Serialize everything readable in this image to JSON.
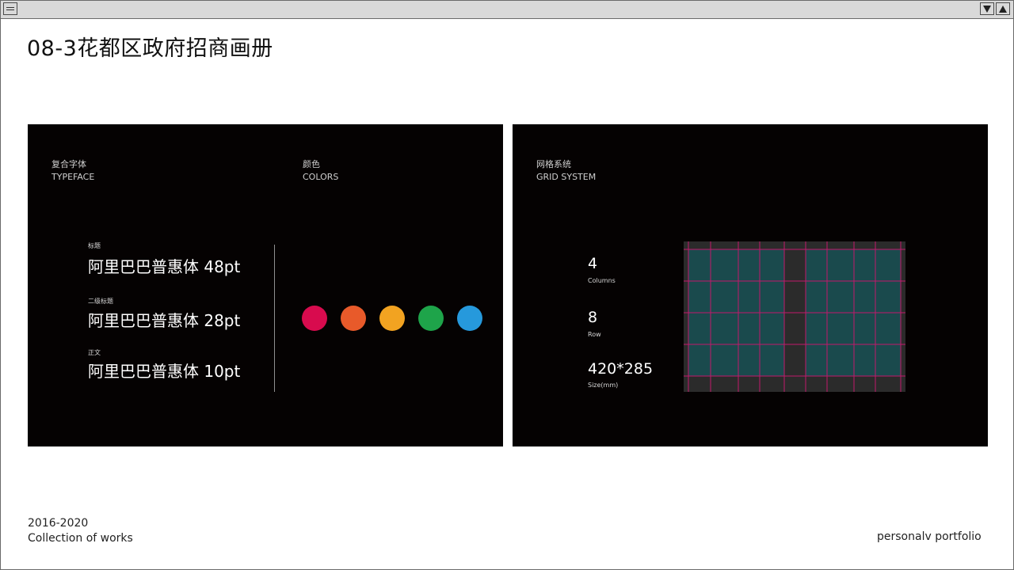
{
  "page_title": "08-3花都区政府招商画册",
  "left_panel": {
    "typeface_cn": "复合字体",
    "typeface_en": "TYPEFACE",
    "colors_cn": "颜色",
    "colors_en": "COLORS",
    "fonts": [
      {
        "label": "标题",
        "sample": "阿里巴巴普惠体 48pt"
      },
      {
        "label": "二级标题",
        "sample": "阿里巴巴普惠体 28pt"
      },
      {
        "label": "正文",
        "sample": "阿里巴巴普惠体 10pt"
      }
    ],
    "swatches": [
      "#d80b4e",
      "#e85a2a",
      "#f2a321",
      "#1ea44a",
      "#2699dc"
    ]
  },
  "right_panel": {
    "grid_cn": "网格系统",
    "grid_en": "GRID SYSTEM",
    "stats": [
      {
        "value": "4",
        "label": "Columns"
      },
      {
        "value": "8",
        "label": "Row"
      },
      {
        "value": "420*285",
        "label": "Size(mm)"
      }
    ]
  },
  "footer": {
    "years": "2016-2020",
    "collection": "Collection of works",
    "portfolio": "personalv portfolio"
  },
  "colors": {
    "panel_bg": "#050202",
    "grid_fill": "#1a4a4d",
    "grid_line": "#c2186b"
  }
}
